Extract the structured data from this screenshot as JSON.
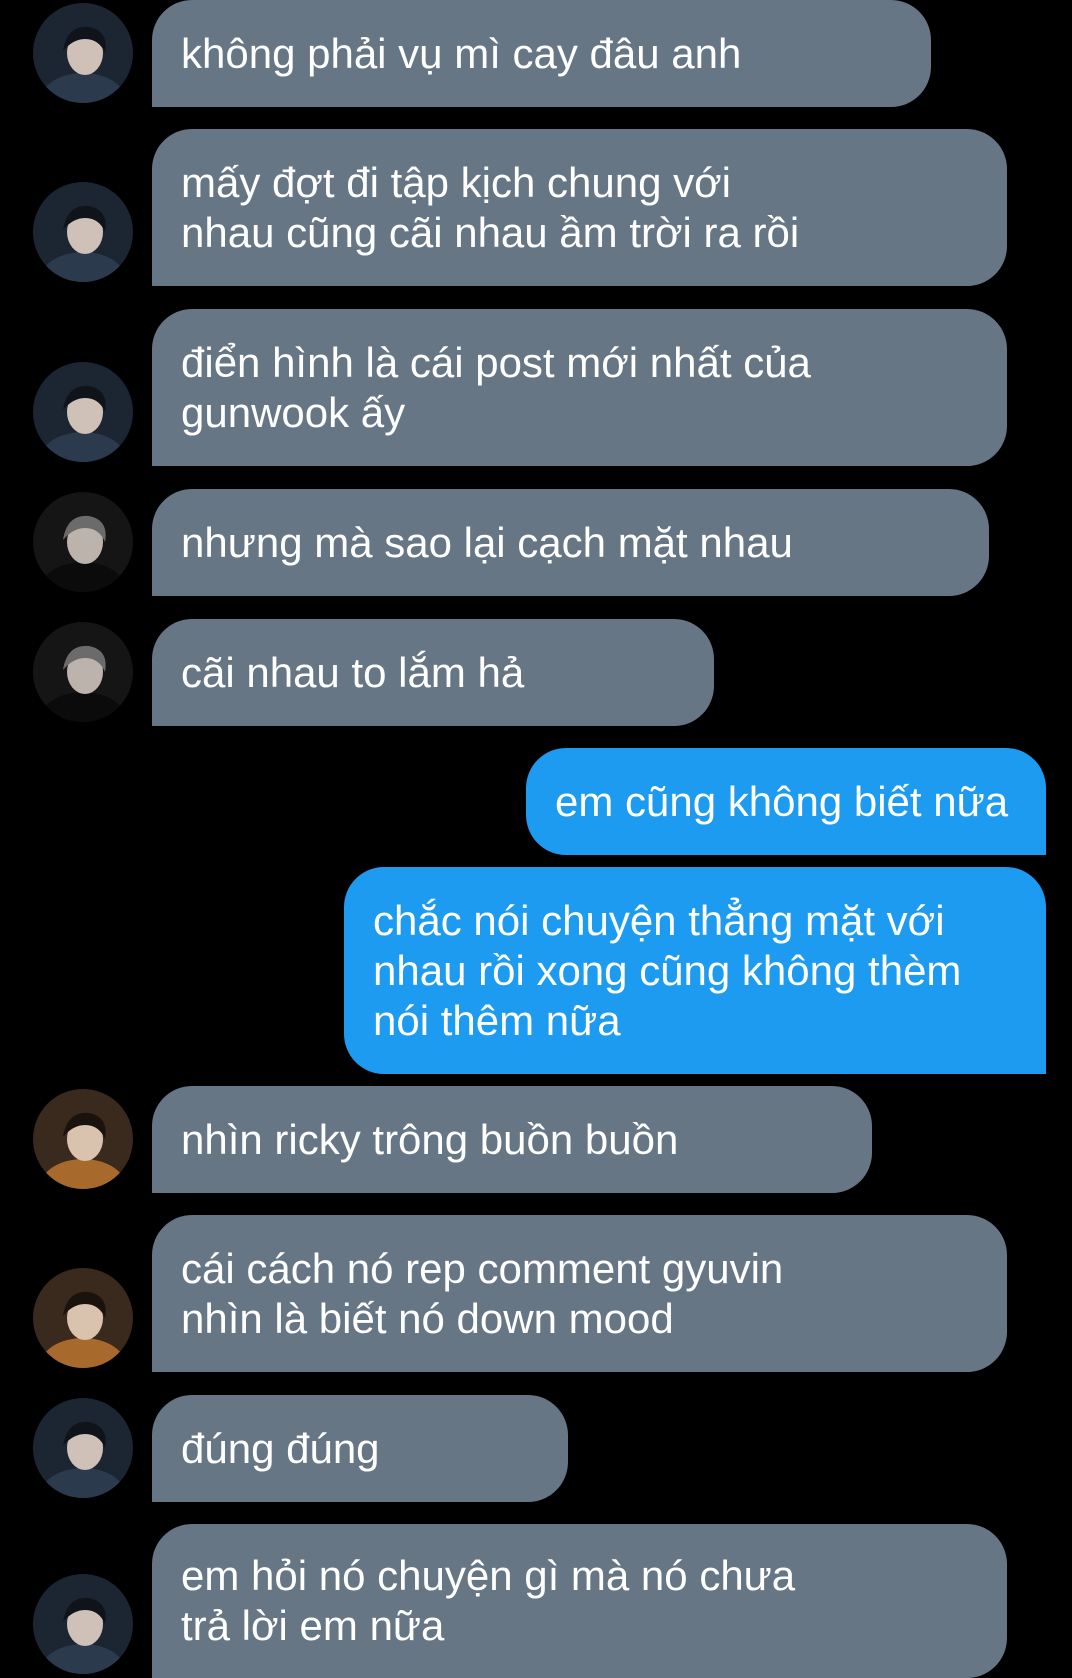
{
  "colors": {
    "background": "#000000",
    "incoming_bubble": "#667685",
    "outgoing_bubble": "#1d9bf0",
    "text": "#ffffff"
  },
  "messages": [
    {
      "side": "incoming",
      "avatar": "avatar-a",
      "lines": [
        "không phải vụ mì cay đâu anh"
      ]
    },
    {
      "side": "incoming",
      "avatar": "avatar-a",
      "lines": [
        "mấy đợt đi tập kịch chung với",
        "nhau cũng cãi nhau ầm trời ra rồi"
      ]
    },
    {
      "side": "incoming",
      "avatar": "avatar-a",
      "lines": [
        "điển hình là cái post mới nhất của",
        "gunwook ấy"
      ]
    },
    {
      "side": "incoming",
      "avatar": "avatar-b",
      "lines": [
        "nhưng mà sao lại cạch mặt nhau"
      ]
    },
    {
      "side": "incoming",
      "avatar": "avatar-b",
      "lines": [
        "cãi nhau to lắm hả"
      ]
    },
    {
      "side": "outgoing",
      "lines": [
        "em cũng không biết nữa"
      ]
    },
    {
      "side": "outgoing",
      "lines": [
        "chắc nói chuyện thẳng mặt với",
        "nhau rồi xong cũng không thèm",
        "nói thêm nữa"
      ]
    },
    {
      "side": "incoming",
      "avatar": "avatar-c",
      "lines": [
        "nhìn ricky trông buồn buồn"
      ]
    },
    {
      "side": "incoming",
      "avatar": "avatar-c",
      "lines": [
        "cái cách nó rep comment gyuvin",
        "nhìn là biết nó down mood"
      ]
    },
    {
      "side": "incoming",
      "avatar": "avatar-a",
      "lines": [
        "đúng đúng"
      ]
    },
    {
      "side": "incoming",
      "avatar": "avatar-a",
      "lines": [
        "em hỏi nó chuyện gì mà nó chưa",
        "trả lời em nữa"
      ]
    }
  ]
}
